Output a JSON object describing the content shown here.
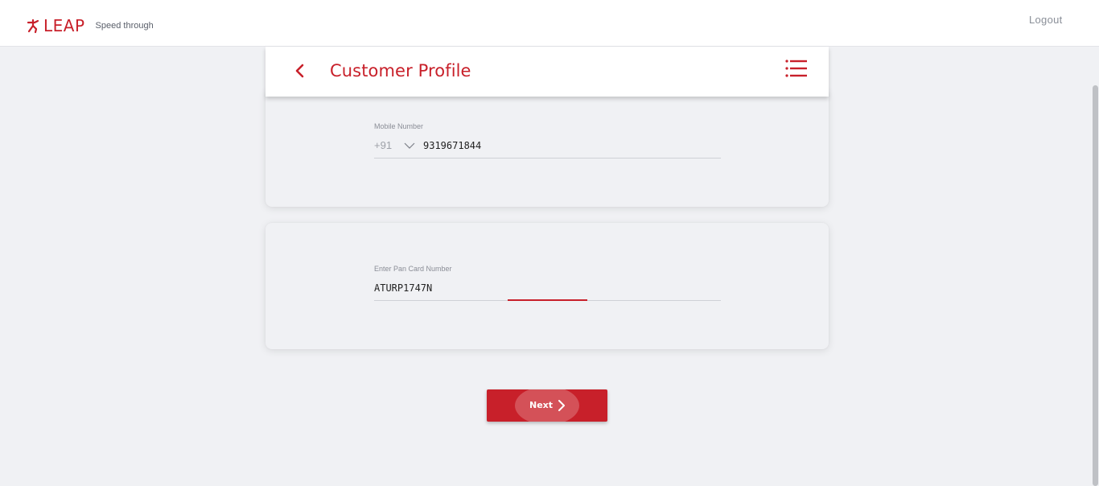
{
  "header": {
    "brand_name": "LEAP",
    "tagline": "Speed through",
    "logout_label": "Logout",
    "brand_icon": "runner-icon"
  },
  "title_bar": {
    "title": "Customer Profile",
    "back_icon": "chevron-left-icon",
    "menu_icon": "list-menu-icon"
  },
  "mobile_section": {
    "label": "Mobile Number",
    "country_code": "+91",
    "value": "9319671844"
  },
  "pan_section": {
    "label": "Enter Pan Card Number",
    "value": "ATURP1747N"
  },
  "actions": {
    "next_label": "Next"
  },
  "colors": {
    "accent": "#c8202a",
    "background": "#f0f1f4"
  }
}
